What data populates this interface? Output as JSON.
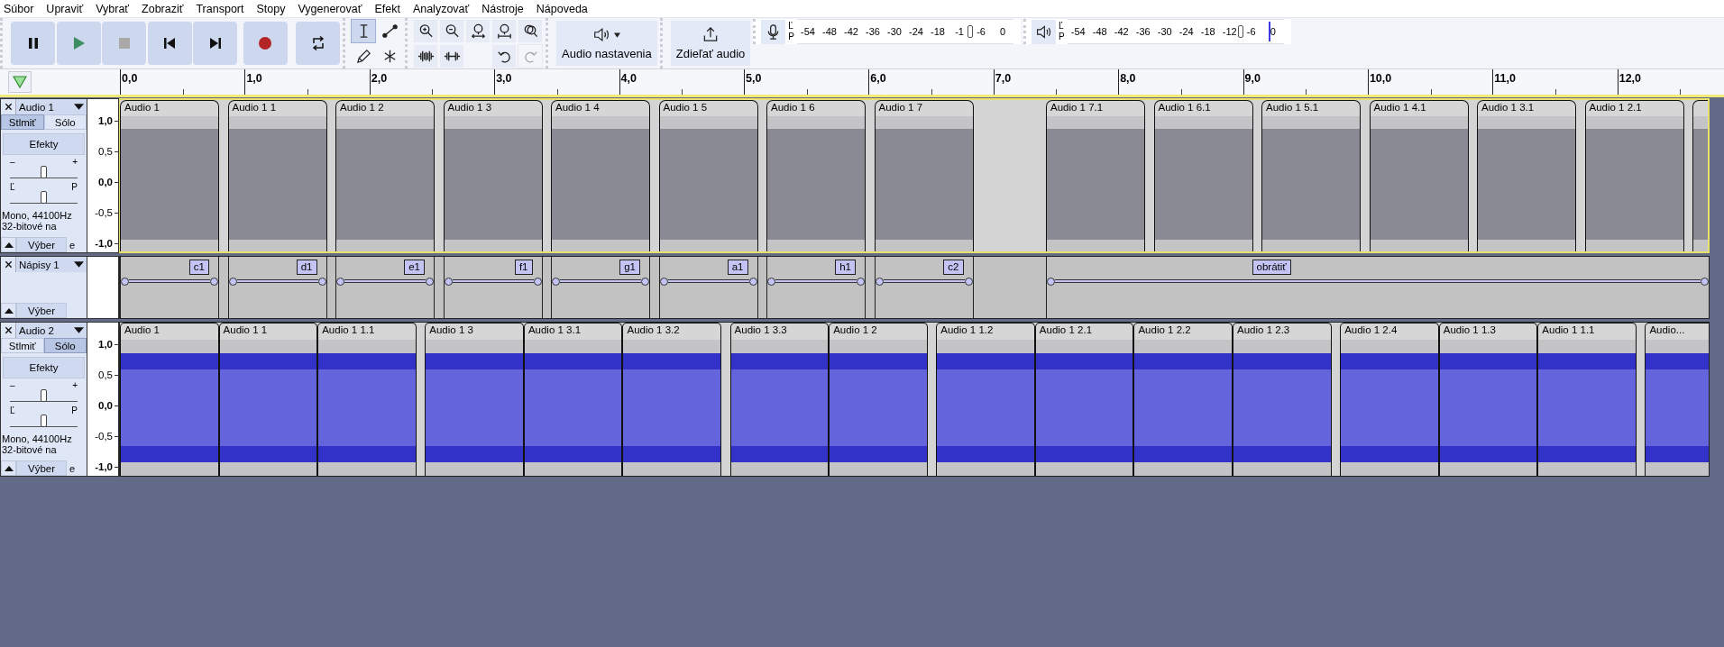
{
  "menu": [
    "Súbor",
    "Upraviť",
    "Vybrať",
    "Zobraziť",
    "Transport",
    "Stopy",
    "Vygenerovať",
    "Efekt",
    "Analyzovať",
    "Nástroje",
    "Nápoveda"
  ],
  "transport": [
    {
      "kind": "pause",
      "disabled": false
    },
    {
      "kind": "play",
      "disabled": false
    },
    {
      "kind": "stop",
      "disabled": true
    },
    {
      "kind": "skip-start",
      "disabled": false
    },
    {
      "kind": "skip-end",
      "disabled": false
    },
    {
      "kind": "record",
      "disabled": false
    },
    {
      "kind": "loop",
      "disabled": false
    }
  ],
  "tools": [
    {
      "kind": "select",
      "selected": true
    },
    {
      "kind": "envelope",
      "selected": false
    },
    {
      "kind": "draw",
      "selected": false
    },
    {
      "kind": "multi",
      "selected": false
    }
  ],
  "edit_buttons": [
    {
      "kind": "zoom-in",
      "disabled": false
    },
    {
      "kind": "zoom-out",
      "disabled": false
    },
    {
      "kind": "fit-selection",
      "disabled": false
    },
    {
      "kind": "fit-project",
      "disabled": false
    },
    {
      "kind": "zoom-toggle",
      "disabled": false
    },
    {
      "kind": "trim",
      "disabled": false
    },
    {
      "kind": "silence",
      "disabled": false
    },
    {
      "kind": "undo",
      "disabled": false
    },
    {
      "kind": "redo",
      "disabled": true
    }
  ],
  "audio_setup": {
    "label": "Audio nastavenia"
  },
  "share": {
    "label": "Zdieľať audio"
  },
  "meters": [
    {
      "kind": "record",
      "channels": [
        "Ľ",
        "P"
      ],
      "scale": [
        "-54",
        "-48",
        "-42",
        "-36",
        "-30",
        "-24",
        "-18",
        "-1",
        "-6",
        "0"
      ],
      "level": 0.8
    },
    {
      "kind": "playback",
      "channels": [
        "Ľ",
        "P"
      ],
      "scale": [
        "-54",
        "-48",
        "-42",
        "-36",
        "-30",
        "-24",
        "-18",
        "-12",
        "-6",
        "0"
      ],
      "level": 0.8
    }
  ],
  "ruler": {
    "ticks": [
      "0,0",
      "1,0",
      "2,0",
      "3,0",
      "4,0",
      "5,0",
      "6,0",
      "7,0",
      "8,0",
      "9,0",
      "10,0",
      "11,0",
      "12,0"
    ]
  },
  "tracks": [
    {
      "kind": "audio",
      "name": "Audio 1",
      "selected": true,
      "mute": true,
      "solo": false,
      "mute_label": "Stlmiť",
      "solo_label": "Sólo",
      "effects_label": "Efekty",
      "gain": {
        "minus": "–",
        "plus": "+",
        "level": 0.5
      },
      "pan": {
        "left": "Ľ",
        "right": "P",
        "level": 0.5
      },
      "info": [
        "Mono, 44100Hz",
        "32-bitové na"
      ],
      "select_label": "Výber",
      "info_tail": "e",
      "scale": [
        "1,0",
        "0,5",
        "0,0",
        "-0,5",
        "-1,0"
      ],
      "waveform": false,
      "clips": [
        {
          "kind": "clip",
          "title": "Audio 1"
        },
        {
          "kind": "clip",
          "title": "Audio 1 1"
        },
        {
          "kind": "clip",
          "title": "Audio 1 2"
        },
        {
          "kind": "clip",
          "title": "Audio 1 3"
        },
        {
          "kind": "clip",
          "title": "Audio 1 4"
        },
        {
          "kind": "clip",
          "title": "Audio 1 5"
        },
        {
          "kind": "clip",
          "title": "Audio 1 6"
        },
        {
          "kind": "clip",
          "title": "Audio 1 7"
        },
        {
          "kind": "gap"
        },
        {
          "kind": "clip",
          "title": "Audio 1 7.1"
        },
        {
          "kind": "clip",
          "title": "Audio 1 6.1"
        },
        {
          "kind": "clip",
          "title": "Audio 1 5.1"
        },
        {
          "kind": "clip",
          "title": "Audio 1 4.1"
        },
        {
          "kind": "clip",
          "title": "Audio 1 3.1"
        },
        {
          "kind": "clip",
          "title": "Audio 1 2.1"
        },
        {
          "kind": "clip"
        }
      ]
    },
    {
      "kind": "label",
      "name": "Nápisy 1",
      "selected": false,
      "select_label": "Výber",
      "labels": [
        {
          "kind": "label",
          "text": "c1"
        },
        {
          "kind": "label",
          "text": "d1"
        },
        {
          "kind": "label",
          "text": "e1"
        },
        {
          "kind": "label",
          "text": "f1"
        },
        {
          "kind": "label",
          "text": "g1"
        },
        {
          "kind": "label",
          "text": "a1"
        },
        {
          "kind": "label",
          "text": "h1"
        },
        {
          "kind": "label",
          "text": "c2"
        },
        {
          "kind": "gap"
        },
        {
          "kind": "label",
          "text": "obrátiť"
        }
      ]
    },
    {
      "kind": "audio",
      "name": "Audio 2",
      "selected": false,
      "mute": false,
      "solo": true,
      "mute_label": "Stlmiť",
      "solo_label": "Sólo",
      "effects_label": "Efekty",
      "gain": {
        "minus": "–",
        "plus": "+",
        "level": 0.5
      },
      "pan": {
        "left": "Ľ",
        "right": "P",
        "level": 0.5
      },
      "info": [
        "Mono, 44100Hz",
        "32-bitové na"
      ],
      "select_label": "Výber",
      "info_tail": "e",
      "scale": [
        "1,0",
        "0,5",
        "0,0",
        "-0,5",
        "-1,0"
      ],
      "waveform": true,
      "clips": [
        {
          "kind": "clip",
          "title": "Audio 1"
        },
        {
          "kind": "clip",
          "title": "Audio 1 1"
        },
        {
          "kind": "clip",
          "title": "Audio 1 1.1"
        },
        {
          "kind": "gap"
        },
        {
          "kind": "clip",
          "title": "Audio 1 3"
        },
        {
          "kind": "clip",
          "title": "Audio 1 3.1"
        },
        {
          "kind": "clip",
          "title": "Audio 1 3.2"
        },
        {
          "kind": "gap"
        },
        {
          "kind": "clip",
          "title": "Audio 1 3.3"
        },
        {
          "kind": "clip",
          "title": "Audio 1 2"
        },
        {
          "kind": "gap"
        },
        {
          "kind": "clip",
          "title": "Audio 1 1.2"
        },
        {
          "kind": "clip",
          "title": "Audio 1 2.1"
        },
        {
          "kind": "clip",
          "title": "Audio 1 2.2"
        },
        {
          "kind": "clip",
          "title": "Audio 1 2.3"
        },
        {
          "kind": "gap"
        },
        {
          "kind": "clip",
          "title": "Audio 1 2.4"
        },
        {
          "kind": "clip",
          "title": "Audio 1 1.3"
        },
        {
          "kind": "clip",
          "title": "Audio 1 1.1"
        },
        {
          "kind": "gap"
        },
        {
          "kind": "clip",
          "title": "Audio..."
        }
      ]
    }
  ]
}
